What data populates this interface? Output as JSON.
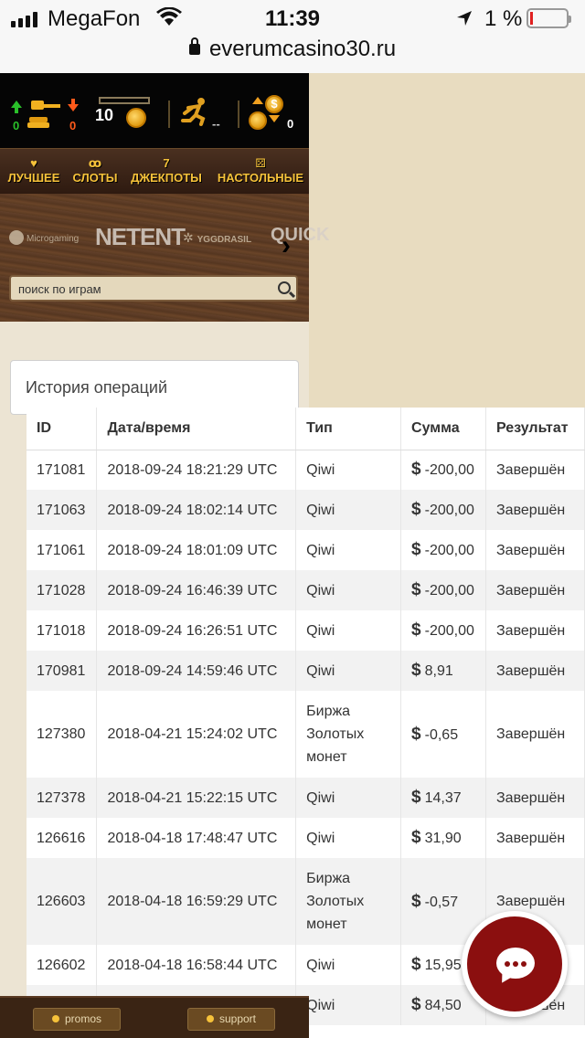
{
  "status_bar": {
    "carrier": "MegaFon",
    "time": "11:39",
    "battery": "1 %",
    "url": "everumcasino30.ru"
  },
  "top_bar": {
    "deposits_up": "0",
    "deposits_down": "0",
    "coins_count": "10",
    "runner_value": "--",
    "exchange_value": "0"
  },
  "nav": {
    "items": [
      {
        "label": "ЛУЧШЕЕ",
        "icon": "heart-icon"
      },
      {
        "label": "СЛОТЫ",
        "icon": "cherries-icon"
      },
      {
        "label": "ДЖЕКПОТЫ",
        "icon": "seven-icon"
      },
      {
        "label": "НАСТОЛЬНЫЕ",
        "icon": "dice-icon"
      }
    ]
  },
  "providers": {
    "items": [
      "Microgaming",
      "NETENT",
      "YGGDRASIL",
      "QUICK"
    ]
  },
  "search": {
    "placeholder": "поиск по играм"
  },
  "history": {
    "title": "История операций",
    "columns": [
      "ID",
      "Дата/время",
      "Тип",
      "Сумма",
      "Результат"
    ],
    "rows": [
      {
        "id": "171081",
        "datetime": "2018-09-24 18:21:29 UTC",
        "type": "Qiwi",
        "currency": "$",
        "amount": "-200,00",
        "result": "Завершён"
      },
      {
        "id": "171063",
        "datetime": "2018-09-24 18:02:14 UTC",
        "type": "Qiwi",
        "currency": "$",
        "amount": "-200,00",
        "result": "Завершён"
      },
      {
        "id": "171061",
        "datetime": "2018-09-24 18:01:09 UTC",
        "type": "Qiwi",
        "currency": "$",
        "amount": "-200,00",
        "result": "Завершён"
      },
      {
        "id": "171028",
        "datetime": "2018-09-24 16:46:39 UTC",
        "type": "Qiwi",
        "currency": "$",
        "amount": "-200,00",
        "result": "Завершён"
      },
      {
        "id": "171018",
        "datetime": "2018-09-24 16:26:51 UTC",
        "type": "Qiwi",
        "currency": "$",
        "amount": "-200,00",
        "result": "Завершён"
      },
      {
        "id": "170981",
        "datetime": "2018-09-24 14:59:46 UTC",
        "type": "Qiwi",
        "currency": "$",
        "amount": "8,91",
        "result": "Завершён"
      },
      {
        "id": "127380",
        "datetime": "2018-04-21 15:24:02 UTC",
        "type": "Биржа Золотых монет",
        "currency": "$",
        "amount": "-0,65",
        "result": "Завершён"
      },
      {
        "id": "127378",
        "datetime": "2018-04-21 15:22:15 UTC",
        "type": "Qiwi",
        "currency": "$",
        "amount": "14,37",
        "result": "Завершён"
      },
      {
        "id": "126616",
        "datetime": "2018-04-18 17:48:47 UTC",
        "type": "Qiwi",
        "currency": "$",
        "amount": "31,90",
        "result": "Завершён"
      },
      {
        "id": "126603",
        "datetime": "2018-04-18 16:59:29 UTC",
        "type": "Биржа Золотых монет",
        "currency": "$",
        "amount": "-0,57",
        "result": "Завершён"
      },
      {
        "id": "126602",
        "datetime": "2018-04-18 16:58:44 UTC",
        "type": "Qiwi",
        "currency": "$",
        "amount": "15,95",
        "result": "Завершён"
      },
      {
        "id": "",
        "datetime": "",
        "type": "Qiwi",
        "currency": "$",
        "amount": "84,50",
        "result": "Завершён"
      }
    ]
  },
  "footer": {
    "promos_label": "promos",
    "support_label": "support"
  },
  "colors": {
    "brand_dark": "#050505",
    "nav_gold": "#f6c23a",
    "chat_red": "#8b0f0f",
    "page_beige": "#e8dcc0"
  }
}
